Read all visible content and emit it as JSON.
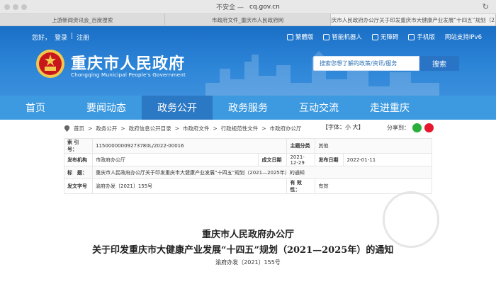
{
  "browser": {
    "security": "不安全 —",
    "url": "cq.gov.cn",
    "tabs": [
      "上游新闻资讯会_百度搜索",
      "市政府文件_重庆市人民政府网",
      "重庆市人民政府办公厅关于印发重庆市大健康产业发展“十四五”规划（2…"
    ]
  },
  "header": {
    "greeting": "您好，",
    "login": "登录",
    "register": "注册",
    "links": [
      "繁體版",
      "智能机器人",
      "无障碍",
      "手机版",
      "网站支持IPv6"
    ],
    "title": "重庆市人民政府",
    "subtitle": "Chongqing Municipal People's Government",
    "search_placeholder": "搜索您想了解的政策/资讯/服务",
    "search_button": "搜索"
  },
  "nav": [
    "首页",
    "要闻动态",
    "政务公开",
    "政务服务",
    "互动交流",
    "走进重庆"
  ],
  "nav_active": "政务公开",
  "breadcrumb": [
    "首页",
    "政务公开",
    "政府信息公开目录",
    "市政府文件",
    "行政规范性文件",
    "市政府办公厅"
  ],
  "font_size": "【字体：小 大】",
  "share_label": "分享到：",
  "meta": {
    "index_label": "索 引 号：",
    "index_value": "11500000009273780L/2022-00016",
    "category_label": "主题分类",
    "category_value": "其他",
    "issuer_label": "发布机构",
    "issuer_value": "市政府办公厅",
    "created_label": "成文日期",
    "created_value": "2021-12-29",
    "published_label": "发布日期",
    "published_value": "2022-01-11",
    "title_label": "标　题：",
    "title_value": "重庆市人民政府办公厅关于印发重庆市大健康产业发展“十四五”规划（2021—2025年）的通知",
    "docno_label": "发文字号",
    "docno_value": "渝府办发〔2021〕155号",
    "validity_label": "有 效 性：",
    "validity_value": "有效"
  },
  "document": {
    "title_line1": "重庆市人民政府办公厅",
    "title_line2": "关于印发重庆市大健康产业发展“十四五”规划（2021—2025年）的通知",
    "doc_number": "渝府办发〔2021〕155号"
  },
  "colors": {
    "header_blue": "#2e86d8",
    "nav_blue": "#3d9ae0",
    "nav_active": "#2b78c5",
    "emblem_red": "#c8161d",
    "emblem_gold": "#f2c94c"
  }
}
